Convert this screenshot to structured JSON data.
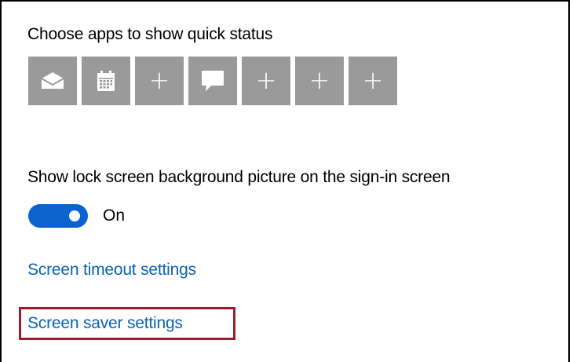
{
  "quick_status": {
    "heading": "Choose apps to show quick status",
    "tiles": [
      {
        "type": "app",
        "icon": "mail-icon"
      },
      {
        "type": "app",
        "icon": "calendar-icon"
      },
      {
        "type": "add",
        "symbol": "+"
      },
      {
        "type": "app",
        "icon": "message-icon"
      },
      {
        "type": "add",
        "symbol": "+"
      },
      {
        "type": "add",
        "symbol": "+"
      },
      {
        "type": "add",
        "symbol": "+"
      }
    ]
  },
  "signin_background": {
    "heading": "Show lock screen background picture on the sign-in screen",
    "toggle_state": "On",
    "toggle_on": true
  },
  "links": {
    "screen_timeout": "Screen timeout settings",
    "screen_saver": "Screen saver settings"
  },
  "colors": {
    "tile_bg": "#9a9a9a",
    "toggle_on": "#0a63cf",
    "link": "#0a63b8",
    "highlight": "#9b1c2a"
  }
}
